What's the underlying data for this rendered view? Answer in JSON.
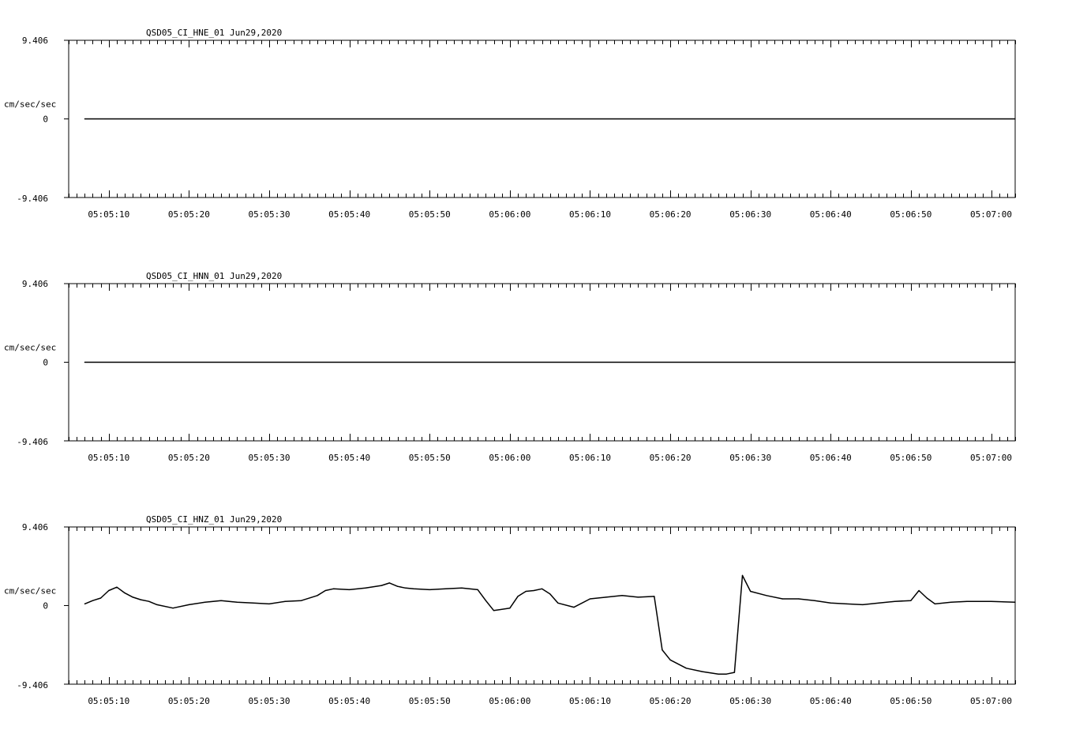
{
  "chart_data": [
    {
      "type": "line",
      "title": "QSD05_CI_HNE_01  Jun29,2020",
      "ylabel": "cm/sec/sec",
      "y_ticks": [
        "9.406",
        "0",
        "-9.406"
      ],
      "ylim": [
        -9.406,
        9.406
      ],
      "xlim": [
        "05:05:05",
        "05:07:03"
      ],
      "x_ticks": [
        "05:05:10",
        "05:05:20",
        "05:05:30",
        "05:05:40",
        "05:05:50",
        "05:06:00",
        "05:06:10",
        "05:06:20",
        "05:06:30",
        "05:06:40",
        "05:06:50",
        "05:07:00"
      ],
      "grid": false,
      "series": [
        {
          "x": [
            "05:05:07",
            "05:07:03"
          ],
          "y": [
            0,
            0
          ]
        }
      ]
    },
    {
      "type": "line",
      "title": "QSD05_CI_HNN_01  Jun29,2020",
      "ylabel": "cm/sec/sec",
      "y_ticks": [
        "9.406",
        "0",
        "-9.406"
      ],
      "ylim": [
        -9.406,
        9.406
      ],
      "xlim": [
        "05:05:05",
        "05:07:03"
      ],
      "x_ticks": [
        "05:05:10",
        "05:05:20",
        "05:05:30",
        "05:05:40",
        "05:05:50",
        "05:06:00",
        "05:06:10",
        "05:06:20",
        "05:06:30",
        "05:06:40",
        "05:06:50",
        "05:07:00"
      ],
      "grid": false,
      "series": [
        {
          "x": [
            "05:05:07",
            "05:07:03"
          ],
          "y": [
            0,
            0
          ]
        }
      ]
    },
    {
      "type": "line",
      "title": "QSD05_CI_HNZ_01  Jun29,2020",
      "ylabel": "cm/sec/sec",
      "y_ticks": [
        "9.406",
        "0",
        "-9.406"
      ],
      "ylim": [
        -9.406,
        9.406
      ],
      "xlim": [
        "05:05:05",
        "05:07:03"
      ],
      "x_ticks": [
        "05:05:10",
        "05:05:20",
        "05:05:30",
        "05:05:40",
        "05:05:50",
        "05:06:00",
        "05:06:10",
        "05:06:20",
        "05:06:30",
        "05:06:40",
        "05:06:50",
        "05:07:00"
      ],
      "grid": false,
      "series": [
        {
          "x": [
            "05:05:07",
            "05:05:08",
            "05:05:09",
            "05:05:10",
            "05:05:11",
            "05:05:12",
            "05:05:13",
            "05:05:14",
            "05:05:15",
            "05:05:16",
            "05:05:18",
            "05:05:20",
            "05:05:22",
            "05:05:24",
            "05:05:26",
            "05:05:28",
            "05:05:30",
            "05:05:32",
            "05:05:34",
            "05:05:36",
            "05:05:37",
            "05:05:38",
            "05:05:40",
            "05:05:42",
            "05:05:44",
            "05:05:45",
            "05:05:46",
            "05:05:47",
            "05:05:48",
            "05:05:50",
            "05:05:52",
            "05:05:54",
            "05:05:56",
            "05:05:57",
            "05:05:58",
            "05:06:00",
            "05:06:01",
            "05:06:02",
            "05:06:03",
            "05:06:04",
            "05:06:05",
            "05:06:06",
            "05:06:08",
            "05:06:10",
            "05:06:12",
            "05:06:14",
            "05:06:16",
            "05:06:18",
            "05:06:19",
            "05:06:20",
            "05:06:22",
            "05:06:24",
            "05:06:26",
            "05:06:27",
            "05:06:28",
            "05:06:29",
            "05:06:30",
            "05:06:32",
            "05:06:34",
            "05:06:36",
            "05:06:38",
            "05:06:40",
            "05:06:42",
            "05:06:44",
            "05:06:46",
            "05:06:48",
            "05:06:50",
            "05:06:51",
            "05:06:52",
            "05:06:53",
            "05:06:55",
            "05:06:57",
            "05:07:00",
            "05:07:03"
          ],
          "y": [
            0.2,
            0.6,
            0.9,
            1.8,
            2.2,
            1.5,
            1.0,
            0.7,
            0.5,
            0.1,
            -0.3,
            0.1,
            0.4,
            0.6,
            0.4,
            0.3,
            0.2,
            0.5,
            0.6,
            1.2,
            1.8,
            2.0,
            1.9,
            2.1,
            2.4,
            2.7,
            2.3,
            2.1,
            2.0,
            1.9,
            2.0,
            2.1,
            1.9,
            0.6,
            -0.6,
            -0.3,
            1.1,
            1.7,
            1.8,
            2.0,
            1.4,
            0.3,
            -0.2,
            0.8,
            1.0,
            1.2,
            1.0,
            1.1,
            -5.3,
            -6.5,
            -7.5,
            -7.9,
            -8.2,
            -8.2,
            -8.0,
            3.6,
            1.7,
            1.2,
            0.8,
            0.8,
            0.6,
            0.3,
            0.2,
            0.1,
            0.3,
            0.5,
            0.6,
            1.8,
            0.9,
            0.2,
            0.4,
            0.5,
            0.5,
            0.4
          ]
        }
      ]
    }
  ]
}
